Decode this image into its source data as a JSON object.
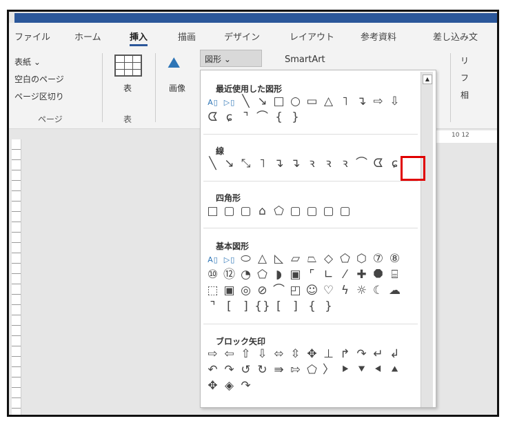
{
  "tabs": [
    "ファイル",
    "ホーム",
    "挿入",
    "描画",
    "デザイン",
    "レイアウト",
    "参考資料",
    "差し込み文"
  ],
  "ribbon": {
    "cover": "表紙 ⌄",
    "blank_page": "空白のページ",
    "page_break": "ページ区切り",
    "page_group": "ページ",
    "table": "表",
    "table_group": "表",
    "image": "画像",
    "shapes": "図形 ⌄",
    "smartart": "SmartArt",
    "right_partial": [
      "リ",
      "フ",
      "相"
    ],
    "ruler_nums": "10   12"
  },
  "dropdown": {
    "sections": [
      {
        "title": "最近使用した図形",
        "rows": [
          [
            "A▯",
            "▷▯",
            "╲",
            "↘",
            "□",
            "○",
            "▭",
            "△",
            "˥",
            "↴",
            "⇨",
            "⇩"
          ],
          [
            "ᗧ",
            "ɕ",
            "⌝",
            "⌒",
            "{",
            "}"
          ]
        ]
      },
      {
        "title": "線",
        "rows": [
          [
            "╲",
            "↘",
            "⤡",
            "˥",
            "↴",
            "↴",
            "ꝛ",
            "ꝛ",
            "ꝛ",
            "⌒",
            "ᗧ",
            "ɕ"
          ]
        ]
      },
      {
        "title": "四角形",
        "rows": [
          [
            "□",
            "▢",
            "▢",
            "⌂",
            "⬠",
            "▢",
            "▢",
            "▢",
            "▢"
          ]
        ]
      },
      {
        "title": "基本図形",
        "rows": [
          [
            "A▯",
            "▷▯",
            "⬭",
            "△",
            "◺",
            "▱",
            "⏢",
            "◇",
            "⬠",
            "⬡",
            "⑦",
            "⑧"
          ],
          [
            "⑩",
            "⑫",
            "◔",
            "⬠",
            "◗",
            "▣",
            "⌜",
            "∟",
            "⁄",
            "✚",
            "⯃",
            "⌸"
          ],
          [
            "⬚",
            "▣",
            "◎",
            "⊘",
            "⌒",
            "◰",
            "☺",
            "♡",
            "ϟ",
            "☼",
            "☾",
            "☁"
          ],
          [
            "⌝",
            "[",
            "]",
            "{}",
            "[",
            "]",
            "{",
            "}"
          ]
        ]
      },
      {
        "title": "ブロック矢印",
        "rows": [
          [
            "⇨",
            "⇦",
            "⇧",
            "⇩",
            "⬄",
            "⇳",
            "✥",
            "⊥",
            "↱",
            "↷",
            "↵",
            "↲"
          ],
          [
            "↶",
            "↷",
            "↺",
            "↻",
            "⇛",
            "⇰",
            "⬠",
            "〉",
            "⯈",
            "⯆",
            "⯇",
            "⯅"
          ],
          [
            "✥",
            "◈",
            "↷"
          ]
        ]
      }
    ]
  },
  "highlight_color": "#e00000"
}
